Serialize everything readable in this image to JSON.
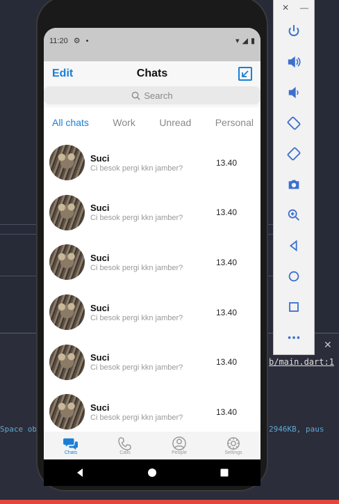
{
  "status_bar": {
    "time": "11:20"
  },
  "header": {
    "edit_label": "Edit",
    "title": "Chats"
  },
  "search": {
    "placeholder": "Search"
  },
  "tabs": [
    {
      "label": "All chats",
      "active": true
    },
    {
      "label": "Work",
      "active": false
    },
    {
      "label": "Unread",
      "active": false
    },
    {
      "label": "Personal",
      "active": false
    }
  ],
  "chats": [
    {
      "name": "Suci",
      "message": "Ci besok pergi kkn jamber?",
      "time": "13.40"
    },
    {
      "name": "Suci",
      "message": "Ci besok pergi kkn jamber?",
      "time": "13.40"
    },
    {
      "name": "Suci",
      "message": "Ci besok pergi kkn jamber?",
      "time": "13.40"
    },
    {
      "name": "Suci",
      "message": "Ci besok pergi kkn jamber?",
      "time": "13.40"
    },
    {
      "name": "Suci",
      "message": "Ci besok pergi kkn jamber?",
      "time": "13.40"
    },
    {
      "name": "Suci",
      "message": "Ci besok pergi kkn jamber?",
      "time": "13.40"
    }
  ],
  "bottom_nav": [
    {
      "label": "Chats",
      "icon": "chat-bubbles-icon",
      "active": true
    },
    {
      "label": "Calls",
      "icon": "phone-icon",
      "active": false
    },
    {
      "label": "People",
      "icon": "person-icon",
      "active": false
    },
    {
      "label": "Settings",
      "icon": "gear-icon",
      "active": false
    }
  ],
  "ide": {
    "link_text": "b/main.dart:1",
    "console_left": "Space ob",
    "console_right": "2946KB, paus"
  },
  "colors": {
    "accent": "#1a7fd4",
    "status_bar": "#c9c9c9",
    "ide_bg": "#272a37"
  }
}
